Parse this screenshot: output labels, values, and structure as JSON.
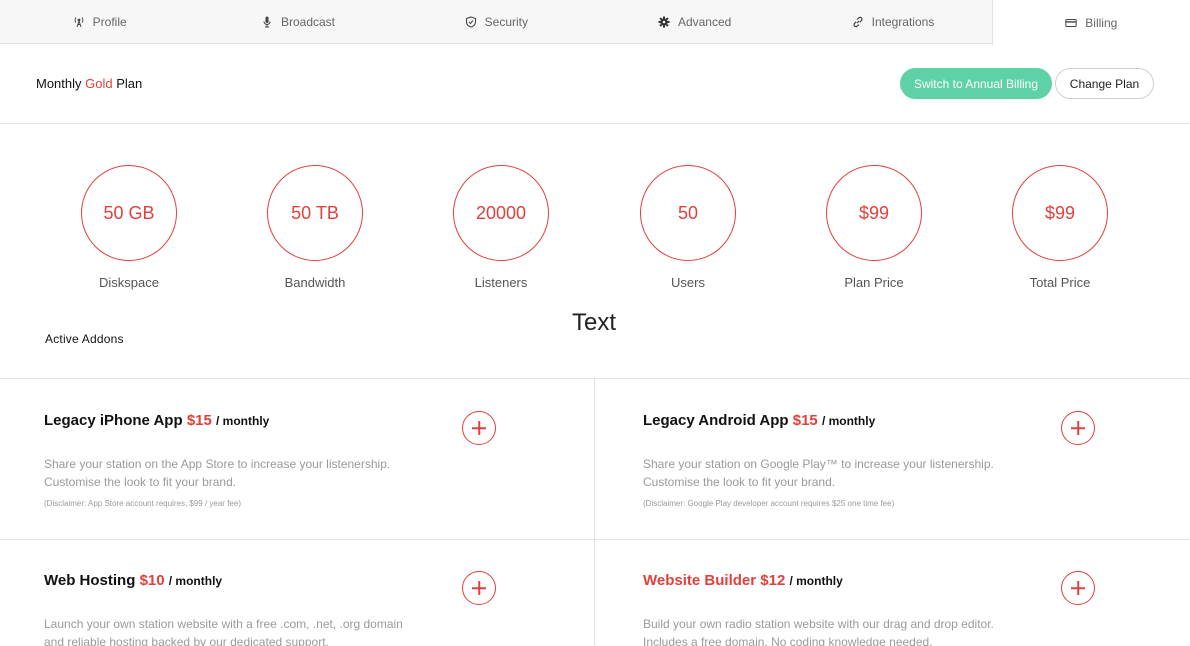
{
  "tabs": [
    {
      "label": "Profile",
      "icon": "antenna-icon"
    },
    {
      "label": "Broadcast",
      "icon": "microphone-icon"
    },
    {
      "label": "Security",
      "icon": "shield-icon"
    },
    {
      "label": "Advanced",
      "icon": "gear-icon"
    },
    {
      "label": "Integrations",
      "icon": "link-icon"
    },
    {
      "label": "Billing",
      "icon": "credit-card-icon",
      "active": true
    }
  ],
  "plan": {
    "prefix": "Monthly",
    "tier": "Gold",
    "suffix": "Plan",
    "switch_label": "Switch to Annual Billing",
    "change_label": "Change Plan"
  },
  "stats": [
    {
      "value": "50 GB",
      "label": "Diskspace"
    },
    {
      "value": "50 TB",
      "label": "Bandwidth"
    },
    {
      "value": "20000",
      "label": "Listeners"
    },
    {
      "value": "50",
      "label": "Users"
    },
    {
      "value": "$99",
      "label": "Plan Price"
    },
    {
      "value": "$99",
      "label": "Total Price"
    }
  ],
  "floating_text": "Text",
  "addons_heading": "Active Addons",
  "addons": [
    {
      "name": "Legacy iPhone App",
      "price": "$15",
      "period": "/ monthly",
      "desc1": "Share your station on the App Store to increase your listenership.",
      "desc2": "Customise the look to fit your brand.",
      "disclaimer": "(Disclaimer: App Store account requires, $99 / year fee)"
    },
    {
      "name": "Legacy Android App",
      "price": "$15",
      "period": "/ monthly",
      "desc1": "Share your station on Google Play™ to increase your listenership.",
      "desc2": "Customise the look to fit your brand.",
      "disclaimer": "(Disclaimer: Google Play developer account requires $25 one time fee)"
    },
    {
      "name": "Web Hosting",
      "price": "$10",
      "period": "/ monthly",
      "desc1": "Launch your own station website with a free .com, .net, .org domain",
      "desc2": "and reliable hosting backed by our dedicated support."
    },
    {
      "name": "Website Builder",
      "price": "$12",
      "period": "/ monthly",
      "desc1": "Build your own radio station website with our drag and drop editor.",
      "desc2": "Includes a free domain. No coding knowledge needed."
    }
  ],
  "colors": {
    "accent_red": "#e0413c",
    "accent_green": "#5fd1a7"
  }
}
